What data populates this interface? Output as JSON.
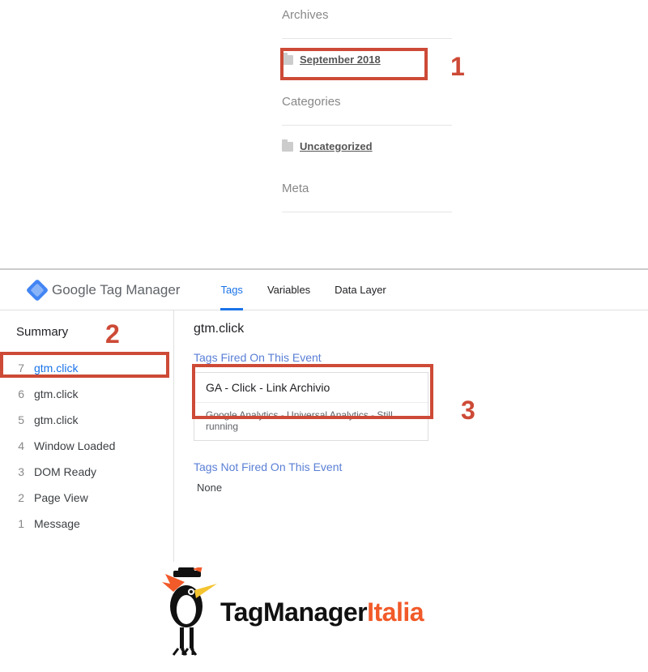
{
  "blog": {
    "archives": {
      "title": "Archives",
      "item": "September 2018"
    },
    "categories": {
      "title": "Categories",
      "item": "Uncategorized"
    },
    "meta": {
      "title": "Meta"
    }
  },
  "annotations": {
    "one": "1",
    "two": "2",
    "three": "3"
  },
  "gtm": {
    "brand": "Google Tag Manager",
    "tabs": {
      "tags": "Tags",
      "variables": "Variables",
      "dataLayer": "Data Layer"
    },
    "summary": "Summary",
    "events": [
      {
        "num": "7",
        "label": "gtm.click",
        "active": true
      },
      {
        "num": "6",
        "label": "gtm.click"
      },
      {
        "num": "5",
        "label": "gtm.click"
      },
      {
        "num": "4",
        "label": "Window Loaded"
      },
      {
        "num": "3",
        "label": "DOM Ready"
      },
      {
        "num": "2",
        "label": "Page View"
      },
      {
        "num": "1",
        "label": "Message"
      }
    ],
    "detail": {
      "title": "gtm.click",
      "firedLabel": "Tags Fired On This Event",
      "tagName": "GA - Click - Link Archivio",
      "tagDesc": "Google Analytics - Universal Analytics - Still running",
      "notFiredLabel": "Tags Not Fired On This Event",
      "none": "None"
    }
  },
  "footer": {
    "brand1": "TagManager",
    "brand2": "Italia"
  }
}
